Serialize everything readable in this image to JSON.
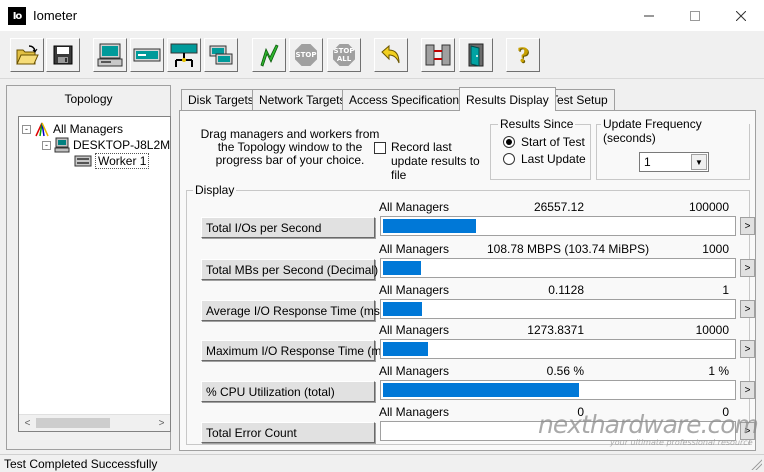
{
  "window": {
    "title": "Iometer",
    "app_icon_label": "Io"
  },
  "toolbar": {
    "buttons": [
      {
        "name": "open-config-button",
        "icon": "folder-open-icon"
      },
      {
        "name": "save-config-button",
        "icon": "floppy-disk-icon"
      },
      {
        "name": "new-disk-worker-button",
        "icon": "disk-worker-icon"
      },
      {
        "name": "new-network-worker-button",
        "icon": "network-worker-icon"
      },
      {
        "name": "add-manager-button",
        "icon": "network-manager-icon"
      },
      {
        "name": "copy-worker-button",
        "icon": "copy-worker-icon"
      },
      {
        "name": "start-tests-button",
        "icon": "green-flag-icon"
      },
      {
        "name": "stop-button",
        "icon": "stop-icon",
        "label": "STOP"
      },
      {
        "name": "stop-all-button",
        "icon": "stop-all-icon",
        "label_top": "STOP",
        "label_bottom": "ALL"
      },
      {
        "name": "reset-workers-button",
        "icon": "reset-arrow-icon"
      },
      {
        "name": "disconnect-managers-button",
        "icon": "disconnect-icon"
      },
      {
        "name": "exit-button",
        "icon": "exit-door-icon"
      },
      {
        "name": "help-button",
        "icon": "question-mark-icon",
        "label": "?"
      }
    ]
  },
  "topology": {
    "label": "Topology",
    "tree": [
      {
        "label": "All Managers",
        "icon": "all-managers-icon",
        "expander": "-"
      },
      {
        "label": "DESKTOP-J8L2M",
        "icon": "computer-icon",
        "expander": "-"
      },
      {
        "label": "Worker 1",
        "icon": "worker-disk-icon"
      }
    ],
    "scroll_left": "<",
    "scroll_right": ">"
  },
  "tabs": [
    {
      "label": "Disk Targets",
      "active": false
    },
    {
      "label": "Network Targets",
      "active": false
    },
    {
      "label": "Access Specifications",
      "active": false
    },
    {
      "label": "Results Display",
      "active": true
    },
    {
      "label": "Test Setup",
      "active": false
    }
  ],
  "results_display": {
    "instructions": "Drag managers and workers from the Topology window to the progress bar of your choice.",
    "record_checkbox": {
      "label": "Record last update results to file",
      "checked": false
    },
    "results_since": {
      "title": "Results Since",
      "options": [
        {
          "label": "Start of Test",
          "selected": true
        },
        {
          "label": "Last Update",
          "selected": false
        }
      ]
    },
    "update_frequency": {
      "title": "Update Frequency (seconds)",
      "value": "1"
    },
    "display": {
      "title": "Display",
      "go_label": ">",
      "metrics": [
        {
          "button": "Total I/Os per Second",
          "source": "All Managers",
          "value": "26557.12",
          "max": "100000",
          "fill": 0.2656
        },
        {
          "button": "Total MBs per Second (Decimal)",
          "source": "All Managers",
          "value": "108.78 MBPS (103.74 MiBPS)",
          "max": "1000",
          "fill": 0.1088
        },
        {
          "button": "Average I/O Response Time (ms)",
          "source": "All Managers",
          "value": "0.1128",
          "max": "1",
          "fill": 0.1128
        },
        {
          "button": "Maximum I/O Response Time (ms)",
          "source": "All Managers",
          "value": "1273.8371",
          "max": "10000",
          "fill": 0.1274
        },
        {
          "button": "% CPU Utilization (total)",
          "source": "All Managers",
          "value": "0.56 %",
          "max": "1 %",
          "fill": 0.56
        },
        {
          "button": "Total Error Count",
          "source": "All Managers",
          "value": "0",
          "max": "0",
          "fill": 0
        }
      ]
    }
  },
  "watermark": {
    "text": "nexthardware.com",
    "tagline": "your ultimate professional resource"
  },
  "status": {
    "text": "Test Completed Successfully"
  }
}
